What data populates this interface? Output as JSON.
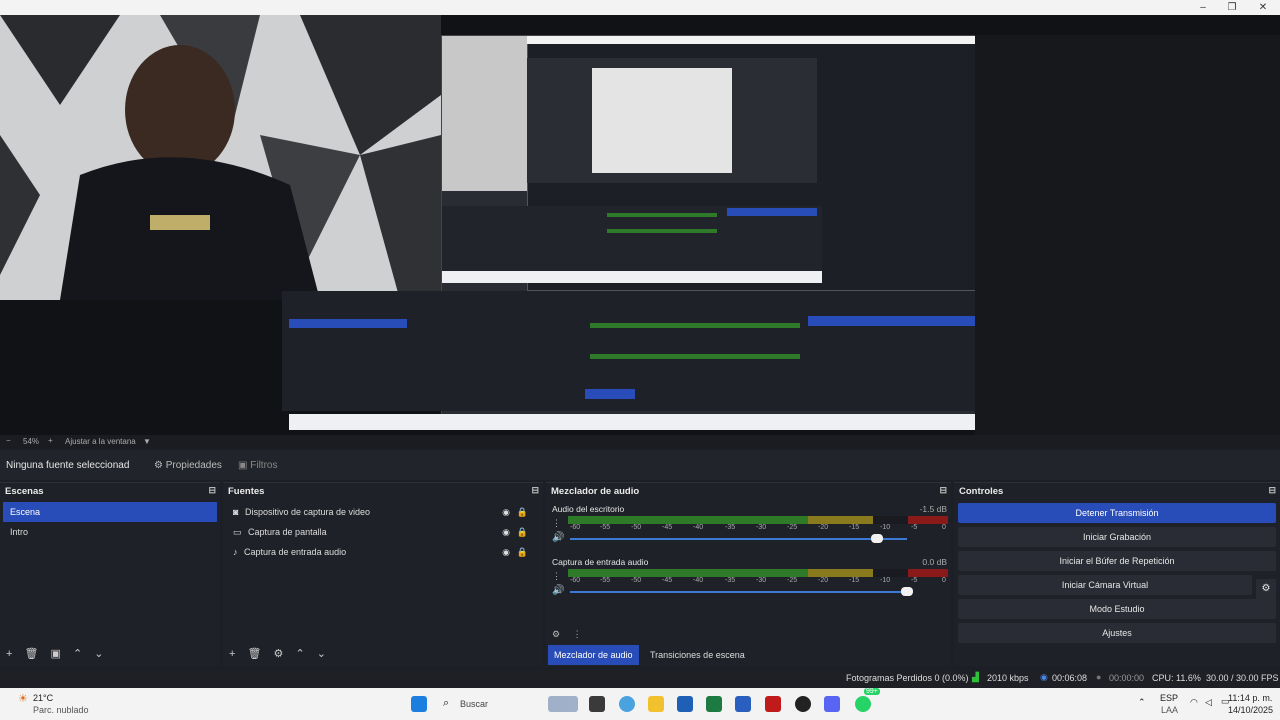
{
  "window": {
    "controls": [
      "–",
      "❐",
      "✕"
    ]
  },
  "zoom_bar": {
    "minus": "−",
    "zoom": "54%",
    "plus": "+",
    "fit": "Ajustar a la ventana",
    "caret": "▼"
  },
  "props_bar": {
    "no_source": "Ninguna fuente seleccionad",
    "properties": "Propiedades",
    "filters": "Filtros"
  },
  "scenes": {
    "title": "Escenas",
    "items": [
      "Escena",
      "Intro"
    ],
    "selected": 0
  },
  "sources": {
    "title": "Fuentes",
    "items": [
      {
        "label": "Dispositivo de captura de video",
        "icon": "camera-icon"
      },
      {
        "label": "Captura de pantalla",
        "icon": "monitor-icon"
      },
      {
        "label": "Captura de entrada audio",
        "icon": "mic-icon"
      }
    ]
  },
  "mixer": {
    "title": "Mezclador de audio",
    "channels": [
      {
        "name": "Audio del escritorio",
        "db": "-1.5 dB",
        "volume": 0.91
      },
      {
        "name": "Captura de entrada audio",
        "db": "0.0 dB",
        "volume": 1.0
      }
    ],
    "ticks": [
      "-60",
      "-55",
      "-50",
      "-45",
      "-40",
      "-35",
      "-30",
      "-25",
      "-20",
      "-15",
      "-10",
      "-5",
      "0"
    ],
    "tabs": [
      "Mezclador de audio",
      "Transiciones de escena"
    ]
  },
  "controls": {
    "title": "Controles",
    "buttons": [
      "Detener Transmisión",
      "Iniciar Grabación",
      "Iniciar el Búfer de Repetición",
      "Iniciar Cámara Virtual",
      "Modo Estudio",
      "Ajustes"
    ]
  },
  "status": {
    "dropped": "Fotogramas Perdidos 0 (0.0%)",
    "bitrate": "2010 kbps",
    "stream_time": "00:06:08",
    "rec_time": "00:00:00",
    "cpu": "CPU: 11.6%",
    "fps": "30.00 / 30.00 FPS"
  },
  "taskbar": {
    "temp": "21°C",
    "weather": "Parc. nublado",
    "search": "Buscar",
    "lang1": "ESP",
    "lang2": "LAA",
    "time": "11:14 p. m.",
    "date": "14/10/2025",
    "badge": "99+"
  },
  "colors": {
    "accent": "#284cb8",
    "green": "#2f7a29",
    "yellow": "#8a7a1e",
    "red": "#8a1a1a"
  }
}
